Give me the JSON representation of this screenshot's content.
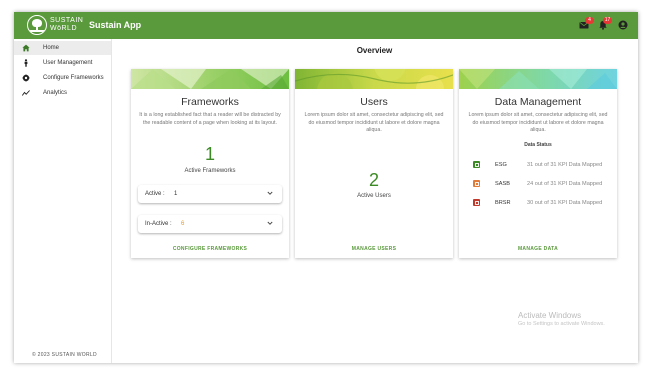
{
  "header": {
    "brand_line1": "SUSTAIN",
    "brand_line2": "WöRLD",
    "app_title": "Sustain App",
    "mail_badge": "4",
    "notif_badge": "17"
  },
  "sidebar": {
    "items": [
      {
        "label": "Home",
        "icon": "home-icon"
      },
      {
        "label": "User Management",
        "icon": "person-icon"
      },
      {
        "label": "Configure Frameworks",
        "icon": "settings-icon"
      },
      {
        "label": "Analytics",
        "icon": "analytics-icon"
      }
    ],
    "copyright": "© 2023 SUSTAIN WORLD"
  },
  "main": {
    "title": "Overview"
  },
  "frameworks": {
    "title": "Frameworks",
    "description": "It is a long established fact that a reader will be distracted by the readable content of a page when looking at its layout.",
    "count": "1",
    "count_label": "Active Frameworks",
    "active_label": "Active :",
    "active_value": "1",
    "inactive_label": "In-Active :",
    "inactive_value": "6",
    "action": "CONFIGURE FRAMEWORKS"
  },
  "users": {
    "title": "Users",
    "description": "Lorem ipsum dolor sit amet, consectetur adipiscing elit, sed do eiusmod tempor incididunt ut labore et dolore magna aliqua.",
    "count": "2",
    "count_label": "Active Users",
    "action": "MANAGE USERS"
  },
  "data_management": {
    "title": "Data Management",
    "description": "Lorem ipsum dolor sit amet, consectetur adipiscing elit, sed do eiusmod tempor incididunt ut labore et dolore magna aliqua.",
    "status_title": "Data Status",
    "rows": [
      {
        "name": "ESG",
        "status": "31 out of 31 KPI Data Mapped",
        "color": "#3c8a25"
      },
      {
        "name": "SASB",
        "status": "24 out of 31 KPI Data Mapped",
        "color": "#e07b39"
      },
      {
        "name": "BRSR",
        "status": "30 out of 31 KPI Data Mapped",
        "color": "#c0392b"
      }
    ],
    "action": "MANAGE DATA"
  },
  "watermark": {
    "title": "Activate Windows",
    "subtitle": "Go to Settings to activate Windows."
  },
  "colors": {
    "brand_green": "#5a9a3c",
    "number_green": "#3c8a25",
    "badge_red": "#e53935",
    "inactive_orange": "#e39b2a"
  }
}
